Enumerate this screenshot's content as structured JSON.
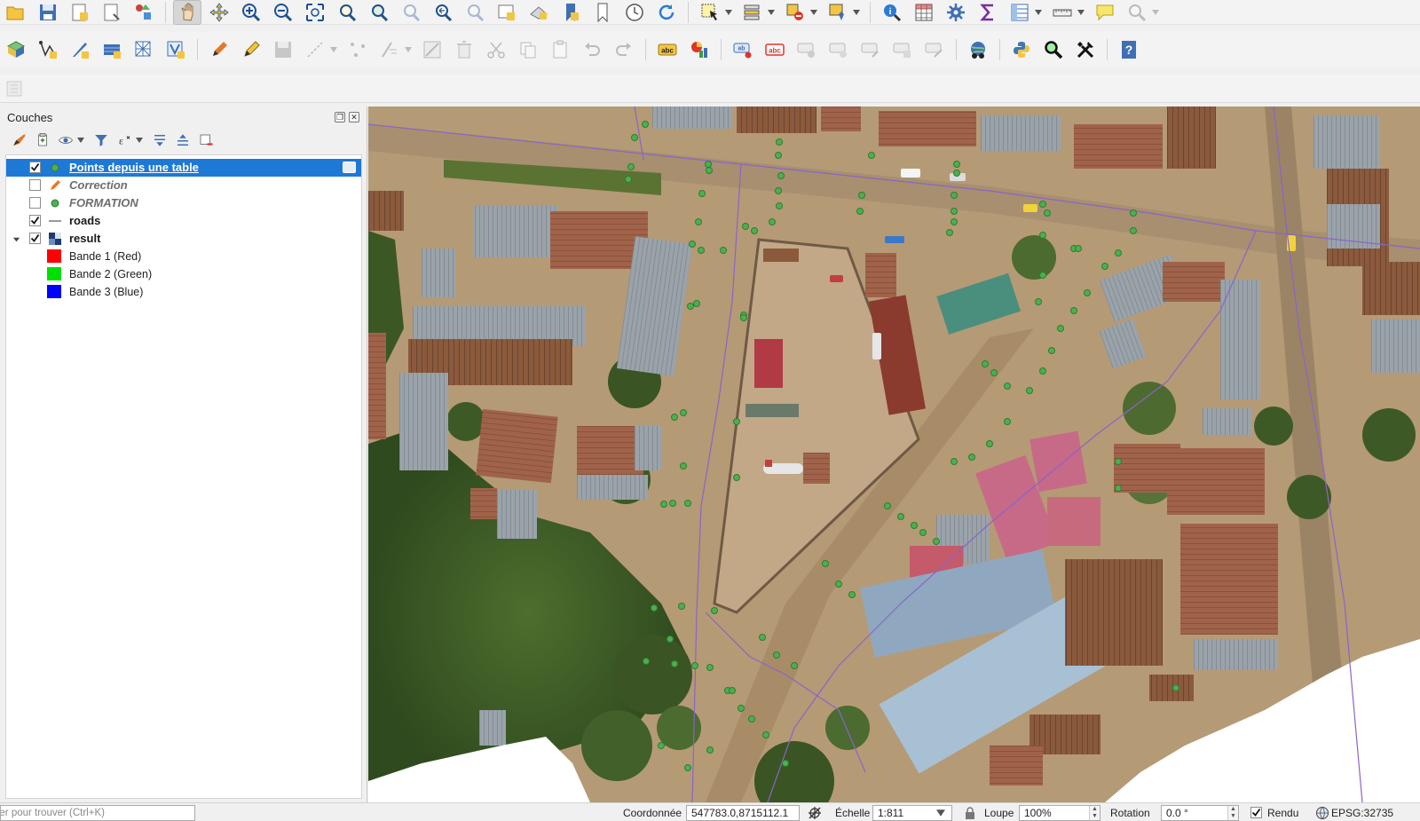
{
  "layers_panel": {
    "title": "Couches",
    "layers": [
      {
        "name": "Points depuis une table",
        "checked": true,
        "selected": true,
        "symbol": "point-symbol-icon",
        "style": "selected"
      },
      {
        "name": "Correction",
        "checked": false,
        "selected": false,
        "symbol": "pen-symbol-icon",
        "style": "italic"
      },
      {
        "name": "FORMATION",
        "checked": false,
        "selected": false,
        "symbol": "point-symbol-icon",
        "style": "italic"
      },
      {
        "name": "roads",
        "checked": true,
        "selected": false,
        "symbol": "line-symbol-icon",
        "style": "bold"
      },
      {
        "name": "result",
        "checked": true,
        "selected": false,
        "symbol": "raster-symbol-icon",
        "style": "bold",
        "expanded": true
      }
    ],
    "bands": [
      {
        "label": "Bande 1 (Red)",
        "color": "#ff0000"
      },
      {
        "label": "Bande 2 (Green)",
        "color": "#00e000"
      },
      {
        "label": "Bande 3 (Blue)",
        "color": "#0000ff"
      }
    ]
  },
  "status_bar": {
    "locator_placeholder": "per pour trouver (Ctrl+K)",
    "coordinate_label": "Coordonnée",
    "coordinate_value": "547783.0,8715112.1",
    "scale_label": "Échelle",
    "scale_value": "1:811",
    "magnifier_label": "Loupe",
    "magnifier_value": "100%",
    "rotation_label": "Rotation",
    "rotation_value": "0.0 °",
    "render_label": "Rendu",
    "render_checked": true,
    "crs_label": "EPSG:32735"
  },
  "colors": {
    "selection": "#1e78d6",
    "road_line": "#8a64c8",
    "point_fill": "#4caf50"
  }
}
